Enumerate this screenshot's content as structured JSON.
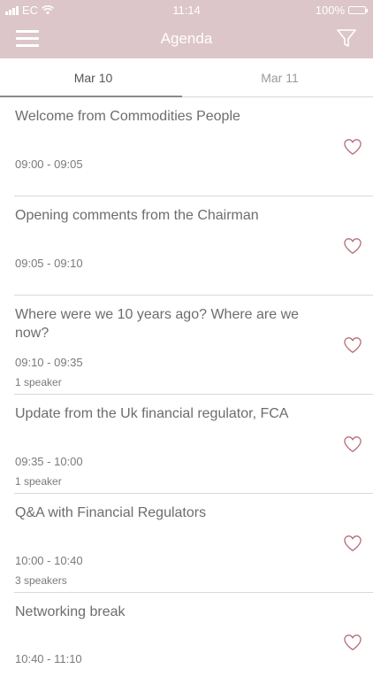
{
  "status_bar": {
    "carrier": "EC",
    "time": "11:14",
    "battery": "100%"
  },
  "navbar": {
    "title": "Agenda"
  },
  "tabs": [
    {
      "label": "Mar 10"
    },
    {
      "label": "Mar 11"
    }
  ],
  "sessions": [
    {
      "title": "Welcome from Commodities People",
      "time": "09:00 - 09:05",
      "speakers": ""
    },
    {
      "title": "Opening comments from the Chairman",
      "time": "09:05 - 09:10",
      "speakers": ""
    },
    {
      "title": "Where were we 10 years ago? Where are we now?",
      "time": "09:10 - 09:35",
      "speakers": "1 speaker"
    },
    {
      "title": "Update from the Uk financial regulator, FCA",
      "time": "09:35 - 10:00",
      "speakers": "1 speaker"
    },
    {
      "title": "Q&A with Financial Regulators",
      "time": "10:00 - 10:40",
      "speakers": "3 speakers"
    },
    {
      "title": "Networking break",
      "time": "10:40 - 11:10",
      "speakers": ""
    }
  ],
  "colors": {
    "header": "#dcc6c9",
    "heart": "#b46a75"
  }
}
